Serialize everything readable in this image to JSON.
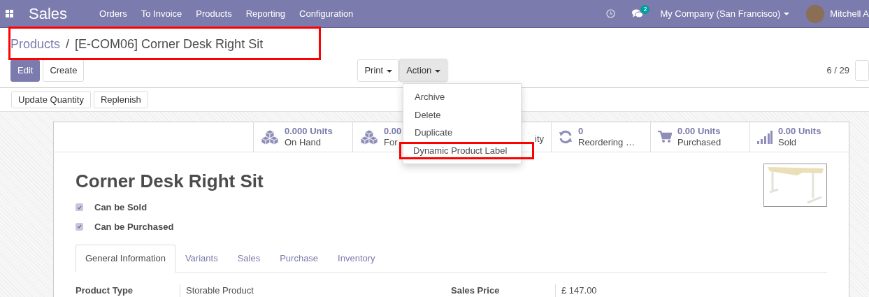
{
  "navbar": {
    "app_name": "Sales",
    "menu": [
      "Orders",
      "To Invoice",
      "Products",
      "Reporting",
      "Configuration"
    ],
    "message_count": "2",
    "company": "My Company (San Francisco)",
    "user": "Mitchell A"
  },
  "breadcrumb": {
    "parent": "Products",
    "separator": "/",
    "current": "[E-COM06] Corner Desk Right Sit",
    "highlighted": true
  },
  "buttons": [
    "Edit",
    "Create"
  ],
  "dropdowns": [
    {
      "label": "Print",
      "open": false
    },
    {
      "label": "Action",
      "open": true
    }
  ],
  "action_menu": [
    {
      "label": "Archive",
      "highlighted": false
    },
    {
      "label": "Delete",
      "highlighted": false
    },
    {
      "label": "Duplicate",
      "highlighted": false
    },
    {
      "label": "Dynamic Product Label",
      "highlighted": true
    }
  ],
  "pager": "6 / 29",
  "header_buttons": [
    "Update Quantity",
    "Replenish"
  ],
  "stats": [
    {
      "kind": "boxes",
      "value": "0.000 Units",
      "label": "On Hand"
    },
    {
      "kind": "boxes",
      "value": "0.00",
      "label": "For"
    },
    {
      "kind": "none",
      "label": "ity"
    },
    {
      "kind": "refresh",
      "value": "0",
      "label": "Reordering …"
    },
    {
      "kind": "cart",
      "value": "0.00 Units",
      "label": "Purchased"
    },
    {
      "kind": "signal",
      "value": "0.00 Units",
      "label": "Sold"
    }
  ],
  "product": {
    "name": "Corner Desk Right Sit",
    "options": [
      {
        "label": "Can be Sold",
        "checked": true
      },
      {
        "label": "Can be Purchased",
        "checked": true
      }
    ]
  },
  "tabs": [
    {
      "label": "General Information",
      "selected": true
    },
    {
      "label": "Variants",
      "selected": false
    },
    {
      "label": "Sales",
      "selected": false
    },
    {
      "label": "Purchase",
      "selected": false
    },
    {
      "label": "Inventory",
      "selected": false
    }
  ],
  "fields": [
    {
      "label": "Product Type",
      "value": "Storable Product"
    },
    {
      "label": "Sales Price",
      "value": "£ 147.00"
    }
  ]
}
